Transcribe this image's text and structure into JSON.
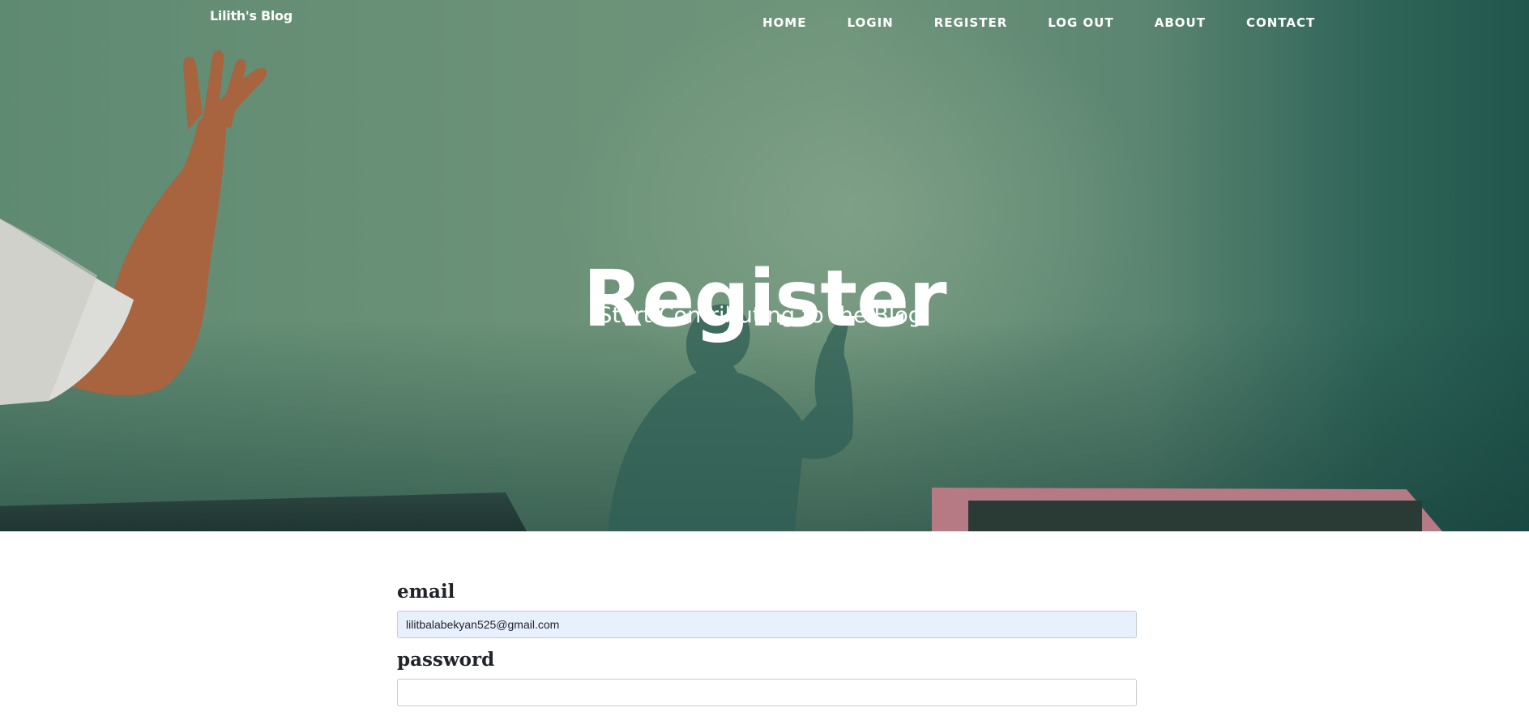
{
  "brand": {
    "title": "Lilith's Blog"
  },
  "nav": {
    "items": [
      {
        "label": "HOME"
      },
      {
        "label": "LOGIN"
      },
      {
        "label": "REGISTER"
      },
      {
        "label": "LOG OUT"
      },
      {
        "label": "ABOUT"
      },
      {
        "label": "CONTACT"
      }
    ]
  },
  "hero": {
    "title": "Register",
    "subtitle": "Start Contributing to the Blog!"
  },
  "form": {
    "email": {
      "label": "email",
      "value": "lilitbalabekyan525@gmail.com"
    },
    "password": {
      "label": "password",
      "value": ""
    }
  },
  "colors": {
    "hero_green": "#6b9278",
    "hero_dark": "#21564d",
    "autofill_bg": "#e8f0fe",
    "text_dark": "#212529"
  }
}
